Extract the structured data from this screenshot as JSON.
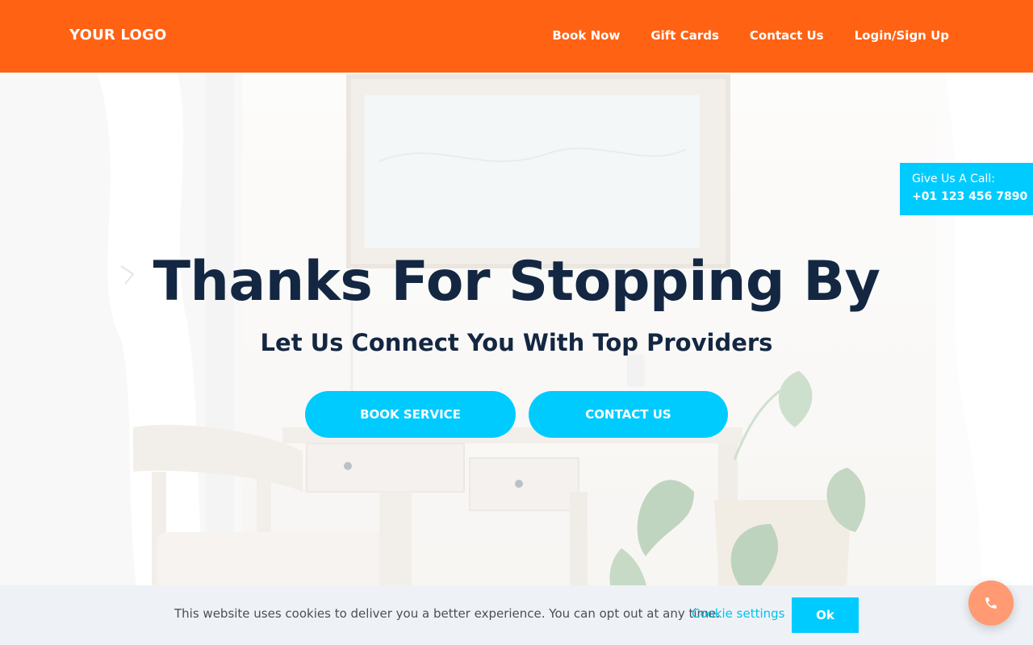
{
  "header": {
    "logo": "YOUR LOGO",
    "nav": [
      {
        "label": "Book Now"
      },
      {
        "label": "Gift Cards"
      },
      {
        "label": "Contact Us"
      },
      {
        "label": "Login/Sign Up"
      }
    ]
  },
  "call_box": {
    "label": "Give Us A Call:",
    "number": "+01 123 456 7890"
  },
  "hero": {
    "title": "Thanks For Stopping By",
    "subtitle": "Let Us Connect You With Top Providers",
    "book_button": "BOOK SERVICE",
    "contact_button": "CONTACT US"
  },
  "cookie": {
    "text": "This website uses cookies to deliver you a better experience. You can opt out at any time.",
    "settings_link": "Cookie settings",
    "ok_button": "Ok"
  },
  "icons": {
    "fab": "phone-icon"
  },
  "colors": {
    "header_bg": "#ff6213",
    "accent": "#00cbff",
    "heading": "#142742",
    "fab": "#ff9a73",
    "cookie_bg": "#eef2f6"
  }
}
